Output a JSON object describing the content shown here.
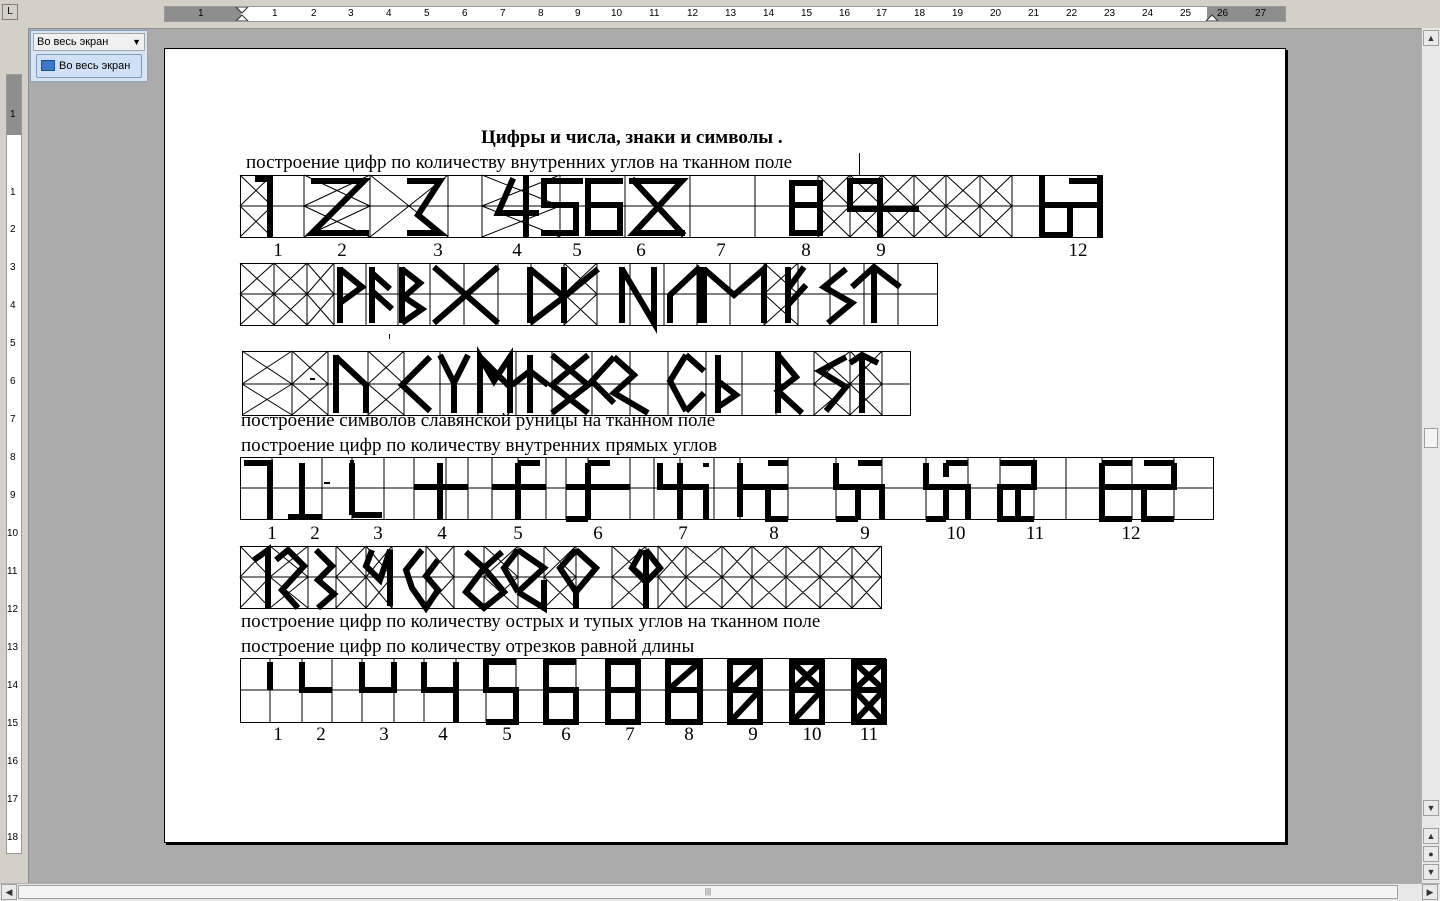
{
  "view_toolbar": {
    "select_value": "Во весь экран",
    "button_label": "Во весь экран",
    "button_icon": "fullscreen-icon"
  },
  "ruler": {
    "top_numbers": [
      "1",
      "1",
      "2",
      "3",
      "4",
      "5",
      "6",
      "7",
      "8",
      "9",
      "10",
      "11",
      "12",
      "13",
      "14",
      "15",
      "16",
      "17",
      "18",
      "19",
      "20",
      "21",
      "22",
      "23",
      "24",
      "25",
      "26",
      "27"
    ],
    "left_numbers": [
      "1",
      "1",
      "2",
      "3",
      "4",
      "5",
      "6",
      "7",
      "8",
      "9",
      "10",
      "11",
      "12",
      "13",
      "14",
      "15",
      "16",
      "17",
      "18"
    ]
  },
  "document": {
    "title": "Цифры и числа,  знаки и символы .",
    "line1": "построение цифр по количеству внутренних углов на тканном поле",
    "row1_numbers": [
      "1",
      "2",
      "3",
      "4",
      "5",
      "6",
      "7",
      "8",
      "9",
      "12"
    ],
    "line2": "построение символов славянской руницы  на тканном поле",
    "line3": "построение цифр по количеству внутренних прямых углов",
    "row4_numbers": [
      "1",
      "2",
      "3",
      "4",
      "5",
      "6",
      "7",
      "8",
      "9",
      "10",
      "11",
      "12"
    ],
    "line4": "построение цифр по количеству острых и тупых углов на тканном поле",
    "line5": "построение цифр по количеству отрезков равной длины",
    "row6_numbers": [
      "1",
      "2",
      "3",
      "4",
      "5",
      "6",
      "7",
      "8",
      "9",
      "10",
      "11"
    ]
  },
  "colors": {
    "workspace": "#ababab",
    "page": "#ffffff",
    "ink": "#000000"
  }
}
